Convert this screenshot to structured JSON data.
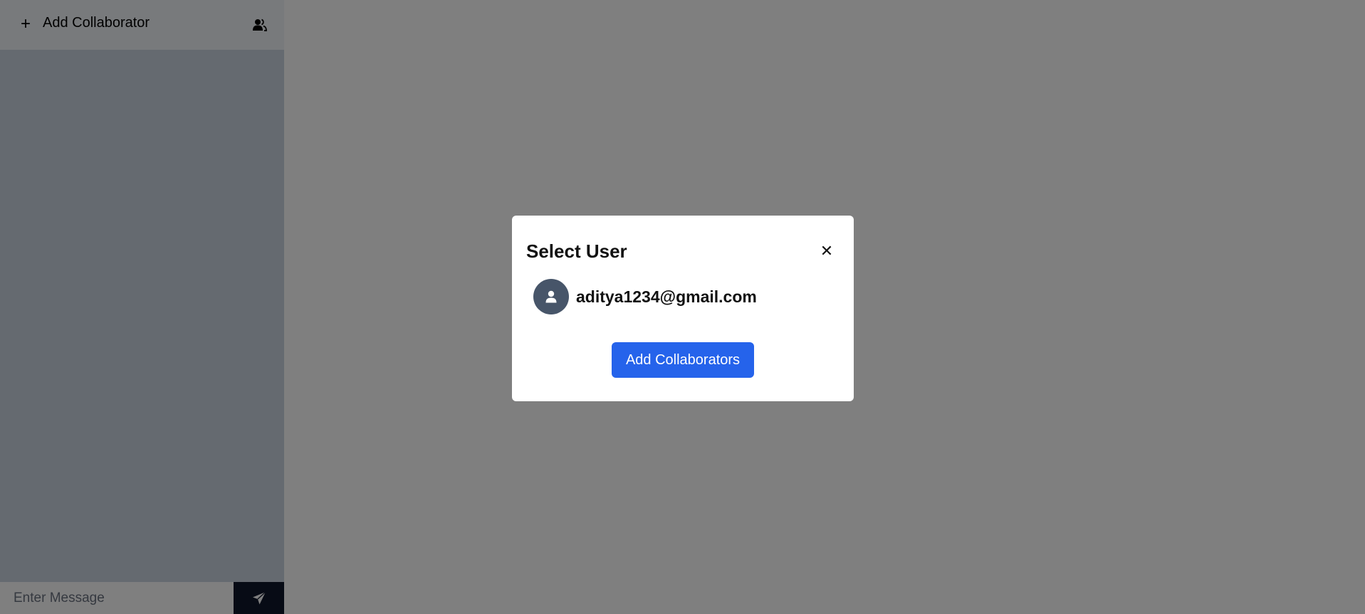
{
  "sidebar": {
    "add_collaborator_label": "Add Collaborator",
    "plus_glyph": "+",
    "collaborators_icon": "users-icon",
    "message_placeholder": "Enter Message",
    "send_icon": "send-icon"
  },
  "modal": {
    "title": "Select User",
    "close_glyph": "✕",
    "users": [
      {
        "email": "aditya1234@gmail.com",
        "icon": "user-icon"
      }
    ],
    "submit_label": "Add Collaborators"
  },
  "colors": {
    "primary_button": "#2563eb",
    "avatar_bg": "#475569",
    "send_button": "#0f172a",
    "overlay": "rgba(0,0,0,0.5)"
  }
}
